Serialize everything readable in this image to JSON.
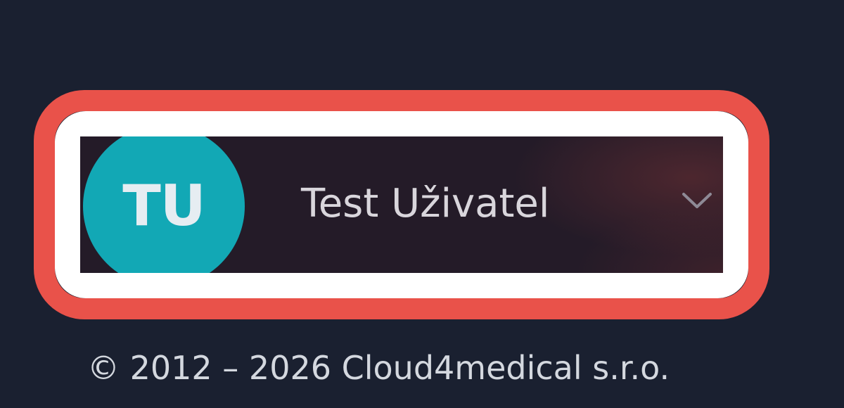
{
  "user_menu": {
    "initials": "TU",
    "name": "Test Uživatel",
    "expand_icon": "chevron-down-icon"
  },
  "footer": {
    "copyright": "© 2012 – 2026 Cloud4medical s.r.o."
  },
  "colors": {
    "background": "#1a2030",
    "avatar": "#12a8b5",
    "highlight_outer": "#e9524a",
    "highlight_inner": "#ffffff"
  }
}
